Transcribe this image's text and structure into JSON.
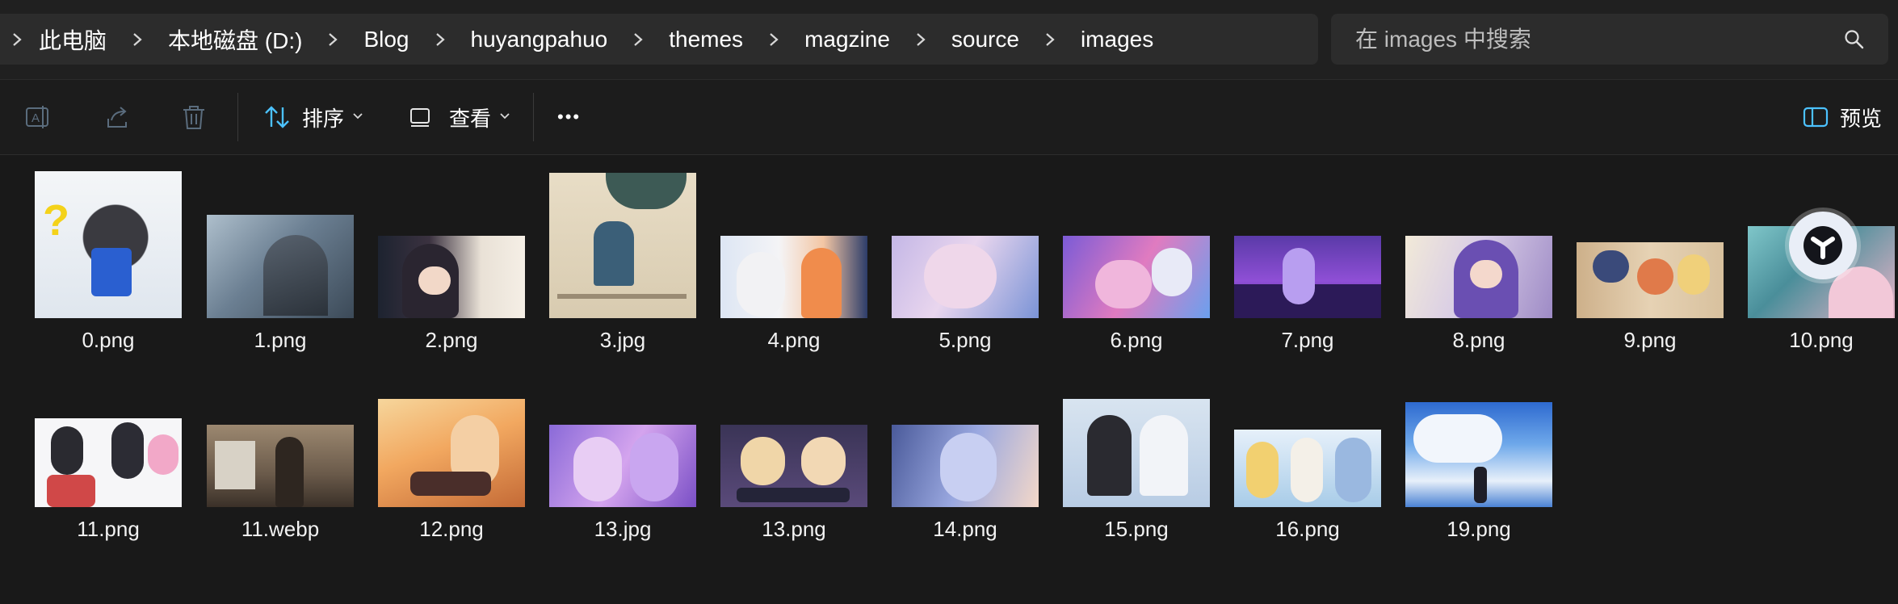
{
  "breadcrumb": [
    "此电脑",
    "本地磁盘 (D:)",
    "Blog",
    "huyangpahuo",
    "themes",
    "magzine",
    "source",
    "images"
  ],
  "search": {
    "placeholder": "在 images 中搜索"
  },
  "toolbar": {
    "sort_label": "排序",
    "view_label": "查看",
    "more_label": "•••",
    "preview_label": "预览"
  },
  "files": [
    {
      "name": "0.png"
    },
    {
      "name": "1.png"
    },
    {
      "name": "2.png"
    },
    {
      "name": "3.jpg"
    },
    {
      "name": "4.png"
    },
    {
      "name": "5.png"
    },
    {
      "name": "6.png"
    },
    {
      "name": "7.png"
    },
    {
      "name": "8.png"
    },
    {
      "name": "9.png"
    },
    {
      "name": "10.png"
    },
    {
      "name": "11.png"
    },
    {
      "name": "11.webp"
    },
    {
      "name": "12.png"
    },
    {
      "name": "13.jpg"
    },
    {
      "name": "13.png"
    },
    {
      "name": "14.png"
    },
    {
      "name": "15.png"
    },
    {
      "name": "16.png"
    },
    {
      "name": "19.png"
    }
  ],
  "colors": {
    "accent": "#4cc2ff",
    "background": "#191919",
    "bar": "#2c2c2c"
  }
}
